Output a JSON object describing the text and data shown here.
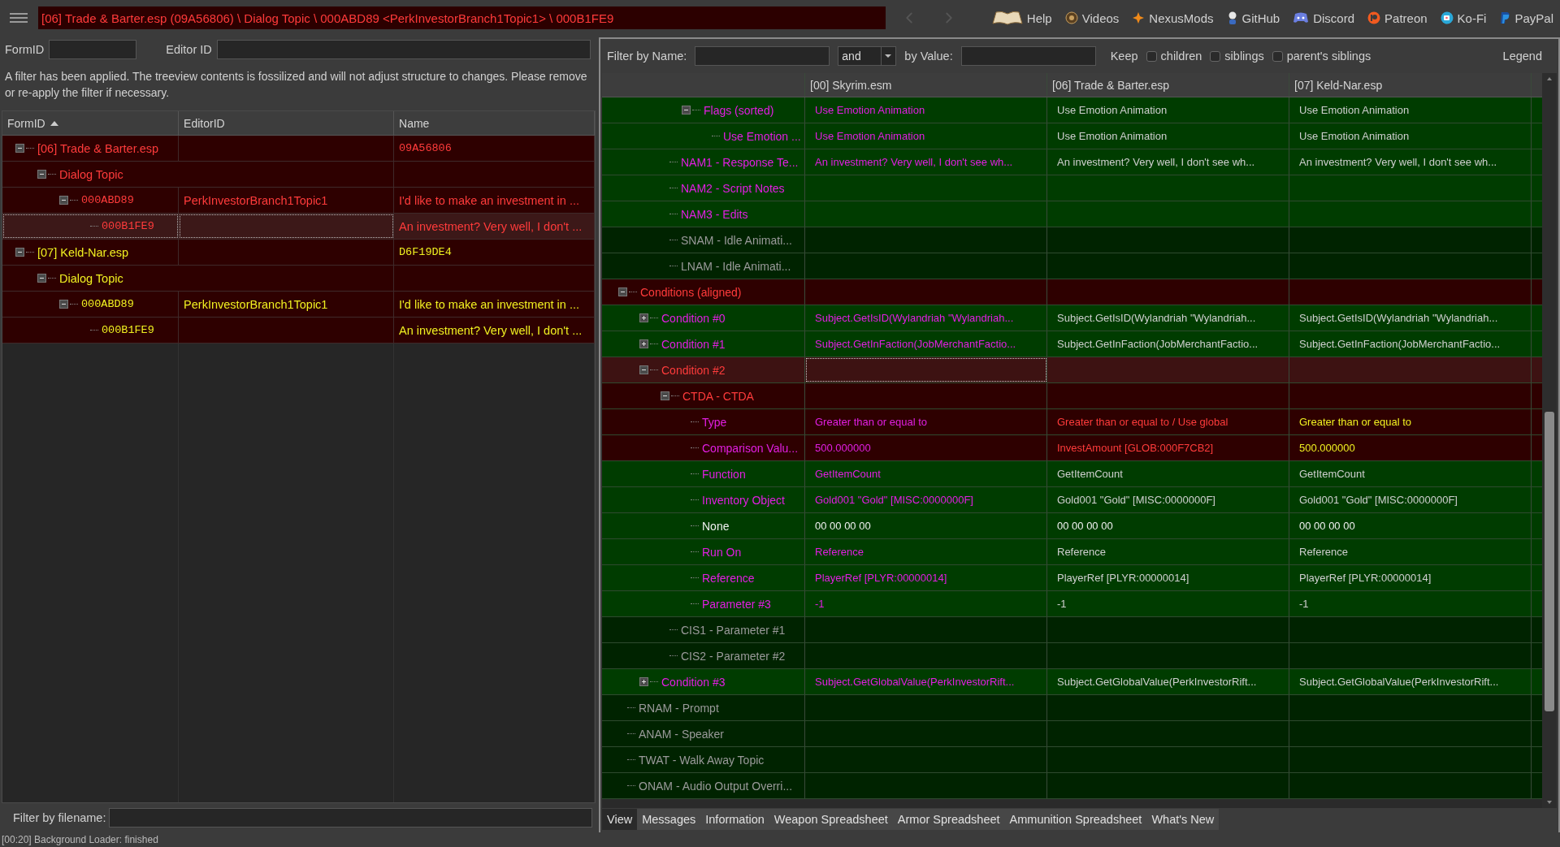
{
  "top_bar": {
    "path": "[06] Trade & Barter.esp (09A56806) \\ Dialog Topic \\ 000ABD89 <PerkInvestorBranch1Topic1> \\ 000B1FE9",
    "nav": [
      {
        "kind": "back",
        "disabled": true
      },
      {
        "kind": "forward",
        "disabled": true
      }
    ],
    "links": [
      {
        "kind": "book",
        "label": "Help"
      },
      {
        "kind": "coin",
        "label": "Videos"
      },
      {
        "kind": "star",
        "label": "NexusMods"
      },
      {
        "kind": "figure",
        "label": "GitHub"
      },
      {
        "kind": "gamepad",
        "label": "Discord"
      },
      {
        "kind": "circle",
        "label": "Patreon"
      },
      {
        "kind": "cup",
        "label": "Ko-Fi"
      },
      {
        "kind": "shield",
        "label": "PayPal"
      }
    ]
  },
  "left_pane": {
    "form_id_label": "FormID",
    "editor_id_label": "Editor ID",
    "notice": "A filter has been applied. The treeview contents is fossilized and will not adjust structure to changes.  Please remove or re-apply the filter if necessary.",
    "tree": {
      "columns": [
        {
          "label": "FormID",
          "sorted": true
        },
        {
          "label": "EditorID",
          "sorted": false
        },
        {
          "label": "Name",
          "sorted": false
        }
      ],
      "rows": [
        {
          "kind": "file",
          "form_id": "[06] Trade & Barter.esp",
          "name": "09A56806",
          "color": "#ff3b3b",
          "expanded": true,
          "selected": false,
          "children": [
            {
              "kind": "group",
              "form_id": "Dialog Topic",
              "color": "#ff3b3b",
              "expanded": true,
              "selected": false,
              "children": [
                {
                  "kind": "record",
                  "form_id": "000ABD89",
                  "editor_id": "PerkInvestorBranch1Topic1",
                  "name": "I'd like to make an investment in ...",
                  "color": "#ff3b3b",
                  "expanded": true,
                  "selected": false,
                  "children": [
                    {
                      "kind": "record",
                      "form_id": "000B1FE9",
                      "name": "An investment? Very well, I don't ...",
                      "color": "#ff3b3b",
                      "selected": true
                    }
                  ]
                }
              ]
            }
          ]
        },
        {
          "kind": "file",
          "form_id": "[07] Keld-Nar.esp",
          "name": "D6F19DE4",
          "color": "#f0f020",
          "expanded": true,
          "selected": false,
          "children": [
            {
              "kind": "group",
              "form_id": "Dialog Topic",
              "color": "#f0f020",
              "expanded": true,
              "selected": false,
              "children": [
                {
                  "kind": "record",
                  "form_id": "000ABD89",
                  "editor_id": "PerkInvestorBranch1Topic1",
                  "name": "I'd like to make an investment in ...",
                  "color": "#f0f020",
                  "expanded": true,
                  "selected": false,
                  "children": [
                    {
                      "kind": "record",
                      "form_id": "000B1FE9",
                      "name": "An investment? Very well, I don't ...",
                      "color": "#f0f020",
                      "selected": false
                    }
                  ]
                }
              ]
            }
          ]
        }
      ]
    },
    "filename_filter_label": "Filter by filename:"
  },
  "right_pane": {
    "filter": {
      "name_label": "Filter by Name:",
      "operator": "and",
      "value_label": "by Value:",
      "keep_label": "Keep",
      "options": [
        {
          "label": "children",
          "checked": false
        },
        {
          "label": "siblings",
          "checked": false
        },
        {
          "label": "parent's siblings",
          "checked": false
        }
      ],
      "legend": "Legend"
    },
    "record_view": {
      "columns": [
        "[00] Skyrim.esm",
        "[06] Trade & Barter.esp",
        "[07] Keld-Nar.esp"
      ],
      "rows": [
        {
          "children": [
            {
              "children": [
                {
                  "children": [
                    {
                      "label": "Flags (sorted)",
                      "expanded": true,
                      "kind": "identical",
                      "color": "#e31ee3",
                      "selected": false,
                      "cells": [
                        {
                          "text": "Use Emotion Animation",
                          "color": "#e31ee3"
                        },
                        {
                          "text": "Use Emotion Animation",
                          "color": "#cfcfcf"
                        },
                        {
                          "text": "Use Emotion Animation",
                          "color": "#cfcfcf"
                        }
                      ],
                      "children": [
                        {
                          "label": "Use Emotion ...",
                          "kind": "identical",
                          "color": "#e31ee3",
                          "selected": false,
                          "cells": [
                            {
                              "text": "Use Emotion Animation",
                              "color": "#e31ee3"
                            },
                            {
                              "text": "Use Emotion Animation",
                              "color": "#cfcfcf"
                            },
                            {
                              "text": "Use Emotion Animation",
                              "color": "#cfcfcf"
                            }
                          ]
                        }
                      ]
                    }
                  ]
                },
                {
                  "label": "NAM1 - Response Te...",
                  "kind": "identical",
                  "color": "#e31ee3",
                  "selected": false,
                  "cells": [
                    {
                      "text": "An investment? Very well, I don't see wh...",
                      "color": "#e31ee3"
                    },
                    {
                      "text": "An investment? Very well, I don't see wh...",
                      "color": "#cfcfcf"
                    },
                    {
                      "text": "An investment? Very well, I don't see wh...",
                      "color": "#cfcfcf"
                    }
                  ]
                },
                {
                  "label": "NAM2 - Script Notes",
                  "kind": "identical",
                  "color": "#e31ee3",
                  "selected": false
                },
                {
                  "label": "NAM3 - Edits",
                  "kind": "identical",
                  "color": "#e31ee3",
                  "selected": false
                },
                {
                  "label": "SNAM - Idle Animati...",
                  "kind": "empty",
                  "color": "#9a9a9a",
                  "selected": false
                },
                {
                  "label": "LNAM - Idle Animati...",
                  "kind": "empty",
                  "color": "#9a9a9a",
                  "selected": false
                }
              ]
            }
          ]
        },
        {
          "label": "Conditions (aligned)",
          "expanded": true,
          "kind": "conflict",
          "color": "#ff3b3b",
          "selected": false,
          "children": [
            {
              "label": "Condition #0",
              "expanded": false,
              "kind": "identical",
              "color": "#e31ee3",
              "selected": false,
              "cells": [
                {
                  "text": "Subject.GetIsID(Wylandriah \"Wylandriah...",
                  "color": "#e31ee3"
                },
                {
                  "text": "Subject.GetIsID(Wylandriah \"Wylandriah...",
                  "color": "#cfcfcf"
                },
                {
                  "text": "Subject.GetIsID(Wylandriah \"Wylandriah...",
                  "color": "#cfcfcf"
                }
              ]
            },
            {
              "label": "Condition #1",
              "expanded": false,
              "kind": "identical",
              "color": "#e31ee3",
              "selected": false,
              "cells": [
                {
                  "text": "Subject.GetInFaction(JobMerchantFactio...",
                  "color": "#e31ee3"
                },
                {
                  "text": "Subject.GetInFaction(JobMerchantFactio...",
                  "color": "#cfcfcf"
                },
                {
                  "text": "Subject.GetInFaction(JobMerchantFactio...",
                  "color": "#cfcfcf"
                }
              ]
            },
            {
              "label": "Condition #2",
              "expanded": true,
              "kind": "conflict",
              "color": "#ff3b3b",
              "selected": true,
              "children": [
                {
                  "label": "CTDA - CTDA",
                  "expanded": true,
                  "kind": "conflict",
                  "color": "#ff3b3b",
                  "selected": false,
                  "children": [
                    {
                      "label": "Type",
                      "kind": "conflict",
                      "color": "#e31ee3",
                      "selected": false,
                      "cells": [
                        {
                          "text": "Greater than or equal to",
                          "color": "#e31ee3"
                        },
                        {
                          "text": "Greater than or equal to / Use global",
                          "color": "#ff3b3b"
                        },
                        {
                          "text": "Greater than or equal to",
                          "color": "#f0f020"
                        }
                      ]
                    },
                    {
                      "label": "Comparison Valu...",
                      "kind": "conflict",
                      "color": "#e31ee3",
                      "selected": false,
                      "cells": [
                        {
                          "text": "500.000000",
                          "color": "#e31ee3"
                        },
                        {
                          "text": "InvestAmount [GLOB:000F7CB2]",
                          "color": "#ff3b3b"
                        },
                        {
                          "text": "500.000000",
                          "color": "#f0f020"
                        }
                      ]
                    },
                    {
                      "label": "Function",
                      "kind": "identical",
                      "color": "#e31ee3",
                      "selected": false,
                      "cells": [
                        {
                          "text": "GetItemCount",
                          "color": "#e31ee3"
                        },
                        {
                          "text": "GetItemCount",
                          "color": "#cfcfcf"
                        },
                        {
                          "text": "GetItemCount",
                          "color": "#cfcfcf"
                        }
                      ]
                    },
                    {
                      "label": "Inventory Object",
                      "kind": "identical",
                      "color": "#e31ee3",
                      "selected": false,
                      "cells": [
                        {
                          "text": "Gold001 \"Gold\" [MISC:0000000F]",
                          "color": "#e31ee3"
                        },
                        {
                          "text": "Gold001 \"Gold\" [MISC:0000000F]",
                          "color": "#cfcfcf"
                        },
                        {
                          "text": "Gold001 \"Gold\" [MISC:0000000F]",
                          "color": "#cfcfcf"
                        }
                      ]
                    },
                    {
                      "label": "None",
                      "kind": "identical",
                      "color": "#f0f0f0",
                      "selected": false,
                      "cells": [
                        {
                          "text": "00 00 00 00",
                          "color": "#f0f0f0"
                        },
                        {
                          "text": "00 00 00 00",
                          "color": "#f0f0f0"
                        },
                        {
                          "text": "00 00 00 00",
                          "color": "#f0f0f0"
                        }
                      ]
                    },
                    {
                      "label": "Run On",
                      "kind": "identical",
                      "color": "#e31ee3",
                      "selected": false,
                      "cells": [
                        {
                          "text": "Reference",
                          "color": "#e31ee3"
                        },
                        {
                          "text": "Reference",
                          "color": "#cfcfcf"
                        },
                        {
                          "text": "Reference",
                          "color": "#cfcfcf"
                        }
                      ]
                    },
                    {
                      "label": "Reference",
                      "kind": "identical",
                      "color": "#e31ee3",
                      "selected": false,
                      "cells": [
                        {
                          "text": "PlayerRef [PLYR:00000014]",
                          "color": "#e31ee3"
                        },
                        {
                          "text": "PlayerRef [PLYR:00000014]",
                          "color": "#cfcfcf"
                        },
                        {
                          "text": "PlayerRef [PLYR:00000014]",
                          "color": "#cfcfcf"
                        }
                      ]
                    },
                    {
                      "label": "Parameter #3",
                      "kind": "identical",
                      "color": "#e31ee3",
                      "selected": false,
                      "cells": [
                        {
                          "text": "-1",
                          "color": "#e31ee3"
                        },
                        {
                          "text": "-1",
                          "color": "#cfcfcf"
                        },
                        {
                          "text": "-1",
                          "color": "#cfcfcf"
                        }
                      ]
                    }
                  ]
                },
                {
                  "label": "CIS1 - Parameter #1",
                  "kind": "empty",
                  "color": "#9a9a9a",
                  "selected": false
                },
                {
                  "label": "CIS2 - Parameter #2",
                  "kind": "empty",
                  "color": "#9a9a9a",
                  "selected": false
                }
              ]
            },
            {
              "label": "Condition #3",
              "expanded": false,
              "kind": "identical",
              "color": "#e31ee3",
              "selected": false,
              "cells": [
                {
                  "text": "Subject.GetGlobalValue(PerkInvestorRift...",
                  "color": "#e31ee3"
                },
                {
                  "text": "Subject.GetGlobalValue(PerkInvestorRift...",
                  "color": "#cfcfcf"
                },
                {
                  "text": "Subject.GetGlobalValue(PerkInvestorRift...",
                  "color": "#cfcfcf"
                }
              ]
            }
          ]
        },
        {
          "label": "RNAM - Prompt",
          "kind": "empty",
          "color": "#9a9a9a",
          "selected": false
        },
        {
          "label": "ANAM - Speaker",
          "kind": "empty",
          "color": "#9a9a9a",
          "selected": false
        },
        {
          "label": "TWAT - Walk Away Topic",
          "kind": "empty",
          "color": "#9a9a9a",
          "selected": false
        },
        {
          "label": "ONAM - Audio Output Overri...",
          "kind": "empty",
          "color": "#9a9a9a",
          "selected": false
        }
      ]
    },
    "tabs": [
      {
        "label": "View",
        "selected": true
      },
      {
        "label": "Messages",
        "selected": false
      },
      {
        "label": "Information",
        "selected": false
      },
      {
        "label": "Weapon Spreadsheet",
        "selected": false
      },
      {
        "label": "Armor Spreadsheet",
        "selected": false
      },
      {
        "label": "Ammunition Spreadsheet",
        "selected": false
      },
      {
        "label": "What's New",
        "selected": false
      }
    ]
  },
  "status_bar": "[00:20] Background Loader: finished"
}
